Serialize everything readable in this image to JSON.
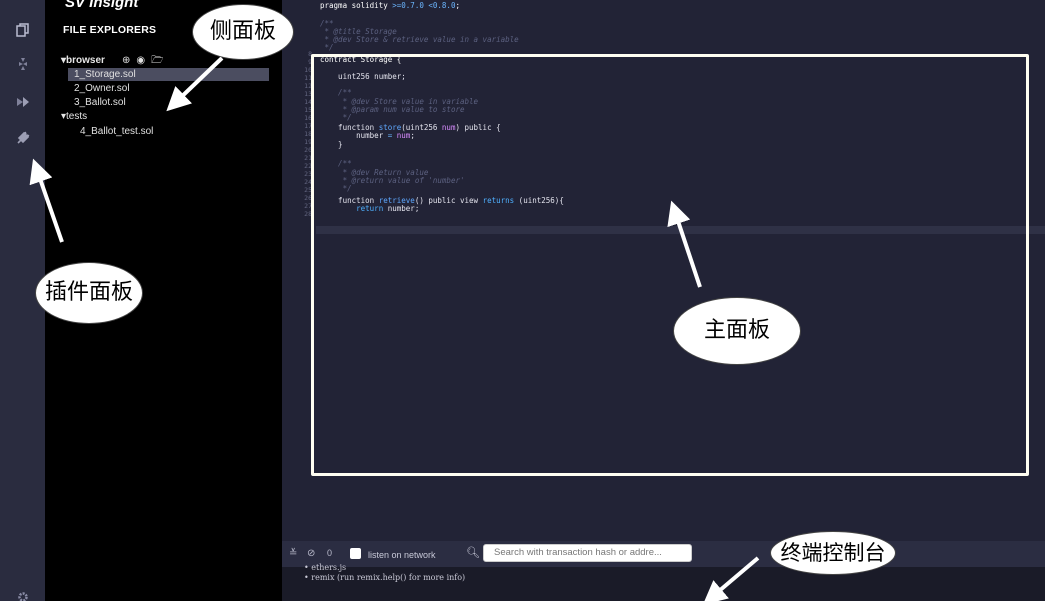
{
  "brand": "SV Insight",
  "side_panel": {
    "title": "FILE EXPLORERS",
    "browser_label": "browser",
    "browser_files": [
      "1_Storage.sol",
      "2_Owner.sol",
      "3_Ballot.sol"
    ],
    "selected_file": "1_Storage.sol",
    "tests_label": "tests",
    "test_files": [
      "4_Ballot_test.sol"
    ]
  },
  "icons": {
    "file_explorer": "files-icon",
    "compiler": "solidity-compiler-icon",
    "deploy": "deploy-run-icon",
    "plugin_manager": "plugin-icon",
    "settings": "settings-gear-icon",
    "new_file": "add-file-icon",
    "github": "github-icon",
    "open_folder": "open-folder-icon"
  },
  "editor": {
    "lines": [
      {
        "n": "",
        "text": "pragma solidity >=0.7.0 <0.8.0;"
      },
      {
        "n": "",
        "text": ""
      },
      {
        "n": "",
        "text": "/**"
      },
      {
        "n": "",
        "text": " * @title Storage"
      },
      {
        "n": "",
        "text": " * @dev Store & retrieve value in a variable"
      },
      {
        "n": "8",
        "text": " */"
      },
      {
        "n": "9",
        "text": "contract Storage {"
      },
      {
        "n": "10",
        "text": ""
      },
      {
        "n": "11",
        "text": "    uint256 number;"
      },
      {
        "n": "12",
        "text": ""
      },
      {
        "n": "13",
        "text": "    /**"
      },
      {
        "n": "14",
        "text": "     * @dev Store value in variable"
      },
      {
        "n": "15",
        "text": "     * @param num value to store"
      },
      {
        "n": "16",
        "text": "     */"
      },
      {
        "n": "17",
        "text": "    function store(uint256 num) public {"
      },
      {
        "n": "18",
        "text": "        number = num;"
      },
      {
        "n": "19",
        "text": "    }"
      },
      {
        "n": "20",
        "text": ""
      },
      {
        "n": "21",
        "text": "    /**"
      },
      {
        "n": "22",
        "text": "     * @dev Return value"
      },
      {
        "n": "23",
        "text": "     * @return value of 'number'"
      },
      {
        "n": "24",
        "text": "     */"
      },
      {
        "n": "25",
        "text": "    function retrieve() public view returns (uint256){"
      },
      {
        "n": "26",
        "text": "        return number;"
      },
      {
        "n": "27",
        "text": "    }"
      },
      {
        "n": "28",
        "text": "}"
      }
    ]
  },
  "terminal": {
    "counter": "0",
    "listen_label": "listen on network",
    "search_placeholder": "Search with transaction hash or addre...",
    "lines": [
      "• ethers.js",
      "• remix (run remix.help() for more info)"
    ]
  },
  "callouts": {
    "side_panel": "侧面板",
    "plugin_panel": "插件面板",
    "main_panel": "主面板",
    "terminal": "终端控制台"
  },
  "colors": {
    "editor_bg": "#222336",
    "side_panel_bg": "#000000",
    "highlight_border": "#fffef2",
    "selected_file_bg": "#4b4d60"
  }
}
